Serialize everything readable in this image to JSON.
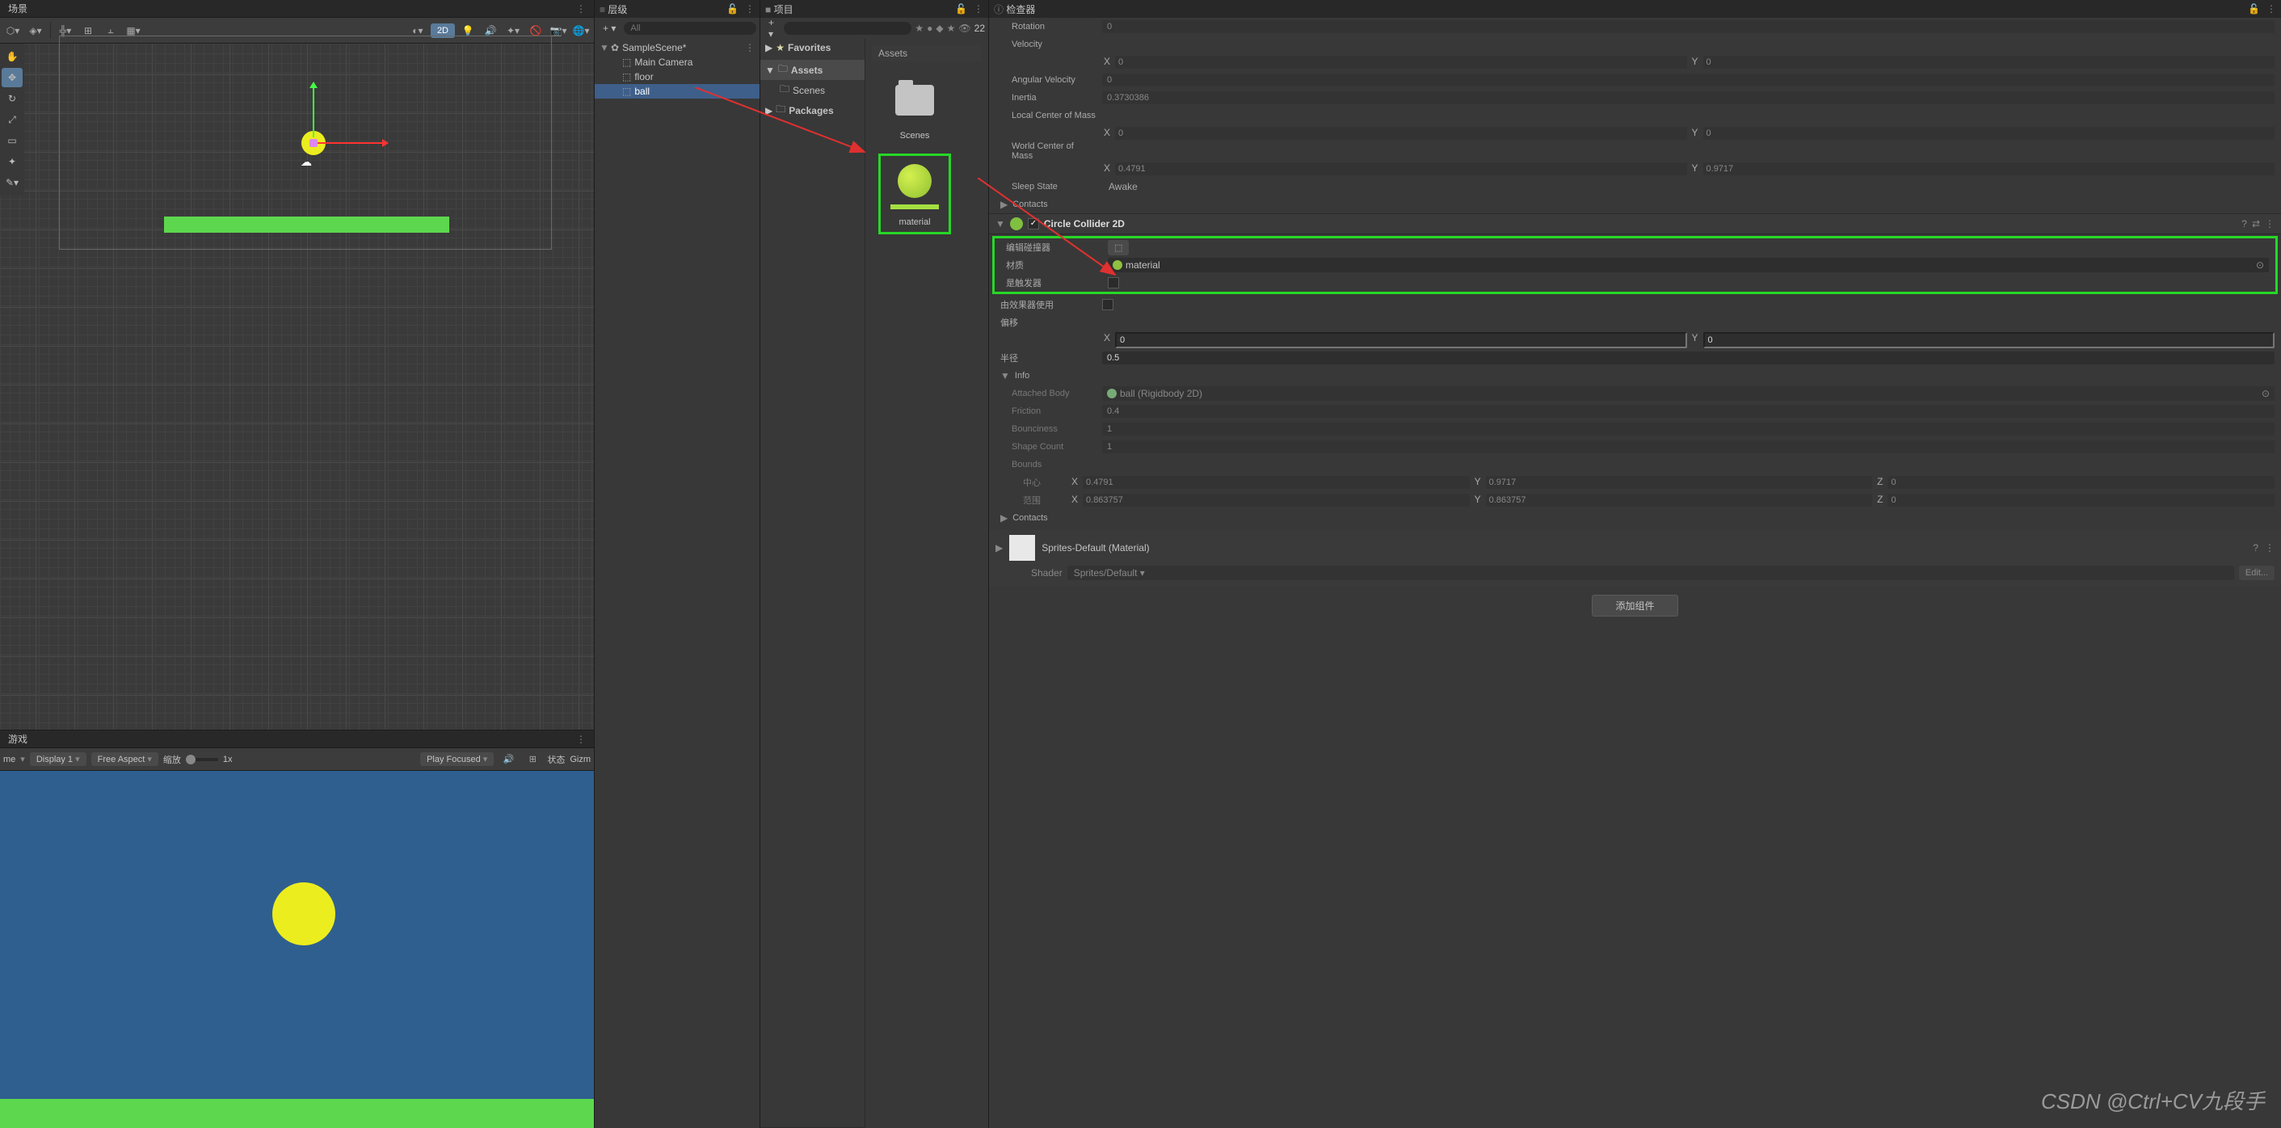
{
  "scene": {
    "tab": "场景"
  },
  "game": {
    "tab": "游戏",
    "display_dropdown": "Display 1",
    "aspect_dropdown": "Free Aspect",
    "scale_label": "缩放",
    "scale_value": "1x",
    "play_focused": "Play Focused",
    "status": "状态",
    "gizmos": "Gizm",
    "me_label": "me"
  },
  "scene_toolbar": {
    "btn_2d": "2D"
  },
  "hierarchy": {
    "tab": "层级",
    "search_placeholder": "All",
    "scene_name": "SampleScene*",
    "items": [
      "Main Camera",
      "floor",
      "ball"
    ]
  },
  "project": {
    "tab": "项目",
    "favorites": "Favorites",
    "tree": {
      "assets": "Assets",
      "scenes": "Scenes",
      "packages": "Packages"
    },
    "grid_header": "Assets",
    "asset1": "Scenes",
    "asset2": "material",
    "visible_count": "22"
  },
  "inspector": {
    "tab": "检查器",
    "rotation": {
      "label": "Rotation",
      "value": "0"
    },
    "velocity": {
      "label": "Velocity",
      "x": "0",
      "y": "0"
    },
    "angular_velocity": {
      "label": "Angular Velocity",
      "value": "0"
    },
    "inertia": {
      "label": "Inertia",
      "value": "0.3730386"
    },
    "local_com": {
      "label": "Local Center of Mass",
      "x": "0",
      "y": "0"
    },
    "world_com": {
      "label": "World Center of Mass",
      "x": "0.4791",
      "y": "0.9717"
    },
    "sleep_state": {
      "label": "Sleep State",
      "value": "Awake"
    },
    "contacts1": "Contacts",
    "circle_collider": {
      "title": "Circle Collider 2D",
      "edit_collider": "编辑碰撞器",
      "material": {
        "label": "材质",
        "value": "material"
      },
      "is_trigger": "是触发器",
      "used_by_effector": "由效果器使用",
      "offset": {
        "label": "偏移",
        "x": "0",
        "y": "0"
      },
      "radius": {
        "label": "半径",
        "value": "0.5"
      },
      "info": {
        "label": "Info",
        "attached_body": {
          "label": "Attached Body",
          "value": "ball (Rigidbody 2D)"
        },
        "friction": {
          "label": "Friction",
          "value": "0.4"
        },
        "bounciness": {
          "label": "Bounciness",
          "value": "1"
        },
        "shape_count": {
          "label": "Shape Count",
          "value": "1"
        },
        "bounds": {
          "label": "Bounds",
          "center": {
            "label": "中心",
            "x": "0.4791",
            "y": "0.9717",
            "z": "0"
          },
          "extents": {
            "label": "范围",
            "x": "0.863757",
            "y": "0.863757",
            "z": "0"
          }
        }
      },
      "contacts2": "Contacts"
    },
    "sprites_mat": {
      "title": "Sprites-Default (Material)",
      "shader_label": "Shader",
      "shader_value": "Sprites/Default",
      "edit_btn": "Edit..."
    },
    "add_component": "添加组件"
  },
  "watermark": "CSDN @Ctrl+CV九段手"
}
